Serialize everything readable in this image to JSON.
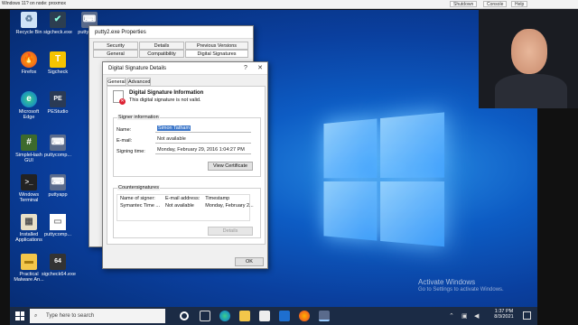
{
  "vm": {
    "window_title": "Windows 11? on node: proxmox",
    "toolbar": [
      "Shutdown",
      "Console",
      "Help"
    ]
  },
  "desktop_icons": [
    {
      "label": "Recycle Bin",
      "icon": "recycle-bin-icon"
    },
    {
      "label": "sigcheck.exe",
      "icon": "sigcheck-icon"
    },
    {
      "label": "putty2.exe",
      "icon": "putty-icon"
    },
    {
      "label": "Firefox",
      "icon": "firefox-icon"
    },
    {
      "label": "Sigcheck",
      "icon": "sigcheck-t-icon"
    },
    {
      "label": "Microsoft Edge",
      "icon": "edge-icon"
    },
    {
      "label": "PEStudio",
      "icon": "pestudio-icon"
    },
    {
      "label": "SimpleHash GUI",
      "icon": "hash-icon"
    },
    {
      "label": "puttycomp...",
      "icon": "putty-icon"
    },
    {
      "label": "Windows Terminal",
      "icon": "terminal-icon"
    },
    {
      "label": "puttyapp",
      "icon": "putty-icon"
    },
    {
      "label": "Installed Applications",
      "icon": "apps-icon"
    },
    {
      "label": "puttycomp...",
      "icon": "file-icon"
    },
    {
      "label": "Practical Malware An...",
      "icon": "folder-icon"
    },
    {
      "label": "sigcheck64.exe",
      "icon": "sigcheck64-icon"
    }
  ],
  "properties": {
    "title": "putty2.exe Properties",
    "tabs_row1": [
      "Security",
      "Details",
      "Previous Versions"
    ],
    "tabs_row2": [
      "General",
      "Compatibility",
      "Digital Signatures"
    ]
  },
  "sigdetails": {
    "title": "Digital Signature Details",
    "help": "?",
    "close": "✕",
    "tabs": [
      "General",
      "Advanced"
    ],
    "info_title": "Digital Signature Information",
    "info_text": "This digital signature is not valid.",
    "signer_group": "Signer information",
    "name_label": "Name:",
    "name_value": "Simon Tatham",
    "email_label": "E-mail:",
    "email_value": "Not available",
    "time_label": "Signing time:",
    "time_value": "Monday, February 29, 2016 1:04:27 PM",
    "view_cert": "View Certificate",
    "counter_group": "Countersignatures",
    "counter_headers": [
      "Name of signer:",
      "E-mail address:",
      "Timestamp"
    ],
    "counter_rows": [
      [
        "Symantec Time ...",
        "Not available",
        "Monday, February 2..."
      ]
    ],
    "details_btn": "Details",
    "ok_btn": "OK"
  },
  "watermark": {
    "title": "Activate Windows",
    "subtitle": "Go to Settings to activate Windows."
  },
  "taskbar": {
    "search_placeholder": "Type here to search",
    "time": "1:37 PM",
    "date": "8/3/2021"
  }
}
